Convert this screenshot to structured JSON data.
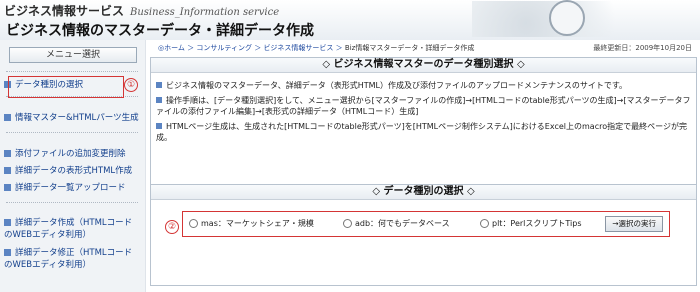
{
  "header": {
    "app_name": "ビジネス情報サービス",
    "app_name_en": "Business_Information service",
    "title": "ビジネス情報のマスターデータ・詳細データ作成"
  },
  "sidebar": {
    "menu_title": "メニュー選択",
    "items": [
      {
        "label": "データ種別の選択"
      },
      {
        "label": "情報マスター&HTMLパーツ生成"
      },
      {
        "label": "添付ファイルの追加変更削除"
      },
      {
        "label": "詳細データの表形式HTML作成"
      },
      {
        "label": "詳細データ一覧アップロード"
      },
      {
        "label": "詳細データ作成（HTMLコードのWEBエディタ利用）"
      },
      {
        "label": "詳細データ修正（HTMLコードのWEBエディタ利用）"
      }
    ],
    "marker_1": "①"
  },
  "breadcrumb": {
    "home": "◎ホーム",
    "consulting": "コンサルティング",
    "service": "ビジネス情報サービス",
    "current": "Biz情報マスターデータ・詳細データ作成",
    "sep": "＞"
  },
  "updated": "最終更新日：2009年10月20日",
  "panel1": {
    "title": "◇ ビジネス情報マスターのデータ種別選択 ◇",
    "p1": "ビジネス情報のマスターデータ、詳細データ（表形式HTML）作成及び添付ファイルのアップロードメンテナンスのサイトです。",
    "p2": "操作手順は、[データ種別選択]をして、メニュー選択から[マスターファイルの作成]→[HTMLコードのtable形式パーツの生成]→[マスターデータファイルの添付ファイル編集]→[表形式の詳細データ（HTMLコード）生成]",
    "p3": "HTMLページ生成は、生成された[HTMLコードのtable形式パーツ]を[HTMLページ制作システム]におけるExcel上のmacro指定で最終ページが完成。"
  },
  "panel2": {
    "title": "◇ データ種別の選択 ◇",
    "options": [
      {
        "label": "mas：マーケットシェア・規模"
      },
      {
        "label": "adb：何でもデータベース"
      },
      {
        "label": "plt：PerlスクリプトTips"
      }
    ],
    "button": "→選択の実行",
    "marker_2": "②"
  }
}
